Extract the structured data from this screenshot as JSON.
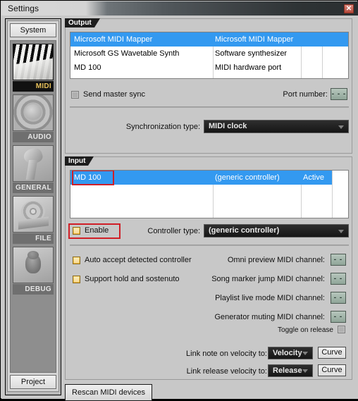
{
  "window": {
    "title": "Settings",
    "close_label": "✕"
  },
  "sidebar": {
    "top_tab": "System",
    "bottom_tab": "Project",
    "items": [
      {
        "label": "MIDI",
        "icon": "midi-keyboard-icon",
        "selected": true
      },
      {
        "label": "AUDIO",
        "icon": "audio-speaker-icon",
        "selected": false
      },
      {
        "label": "GENERAL",
        "icon": "general-horn-icon",
        "selected": false
      },
      {
        "label": "FILE",
        "icon": "file-disc-icon",
        "selected": false
      },
      {
        "label": "DEBUG",
        "icon": "debug-bug-icon",
        "selected": false
      }
    ]
  },
  "output": {
    "group_label": "Output",
    "devices": [
      {
        "name": "Microsoft MIDI Mapper",
        "type": "Microsoft MIDI Mapper",
        "status": "",
        "selected": true
      },
      {
        "name": "Microsoft GS Wavetable Synth",
        "type": "Software synthesizer",
        "status": "",
        "selected": false
      },
      {
        "name": "MD 100",
        "type": "MIDI hardware port",
        "status": "",
        "selected": false
      }
    ],
    "send_master_sync": {
      "label": "Send master sync",
      "checked": false,
      "state": "grey"
    },
    "port_number": {
      "label": "Port number:",
      "value": "- - -"
    },
    "synchronization_type": {
      "label": "Synchronization type:",
      "value": "MIDI clock"
    }
  },
  "input": {
    "group_label": "Input",
    "devices": [
      {
        "name": "MD 100",
        "type": "(generic controller)",
        "status": "Active",
        "selected": true,
        "highlighted": true
      }
    ],
    "enable": {
      "label": "Enable",
      "checked": true,
      "state": "amber",
      "highlighted": true
    },
    "controller_type": {
      "label": "Controller type:",
      "value": "(generic controller)"
    },
    "auto_accept": {
      "label": "Auto accept detected controller",
      "checked": true,
      "state": "amber"
    },
    "support_hold": {
      "label": "Support hold and sostenuto",
      "checked": true,
      "state": "amber"
    },
    "channels": [
      {
        "label": "Omni preview MIDI channel:",
        "value": "- -"
      },
      {
        "label": "Song marker jump MIDI channel:",
        "value": "- -"
      },
      {
        "label": "Playlist live mode MIDI channel:",
        "value": "- -"
      },
      {
        "label": "Generator muting MIDI channel:",
        "value": "- -"
      }
    ],
    "toggle_on_release": {
      "label": "Toggle on release",
      "checked": true,
      "state": "grey"
    },
    "velocity_links": [
      {
        "label": "Link note on velocity to:",
        "value": "Velocity",
        "curve_label": "Curve"
      },
      {
        "label": "Link release velocity to:",
        "value": "Release",
        "curve_label": "Curve"
      }
    ]
  },
  "footer": {
    "rescan_label": "Rescan MIDI devices"
  },
  "colors": {
    "selection_blue": "#3399f0",
    "highlight_red": "#d01f27",
    "checkbox_amber": "#f0b93c",
    "window_bg": "#c8c8c8"
  }
}
